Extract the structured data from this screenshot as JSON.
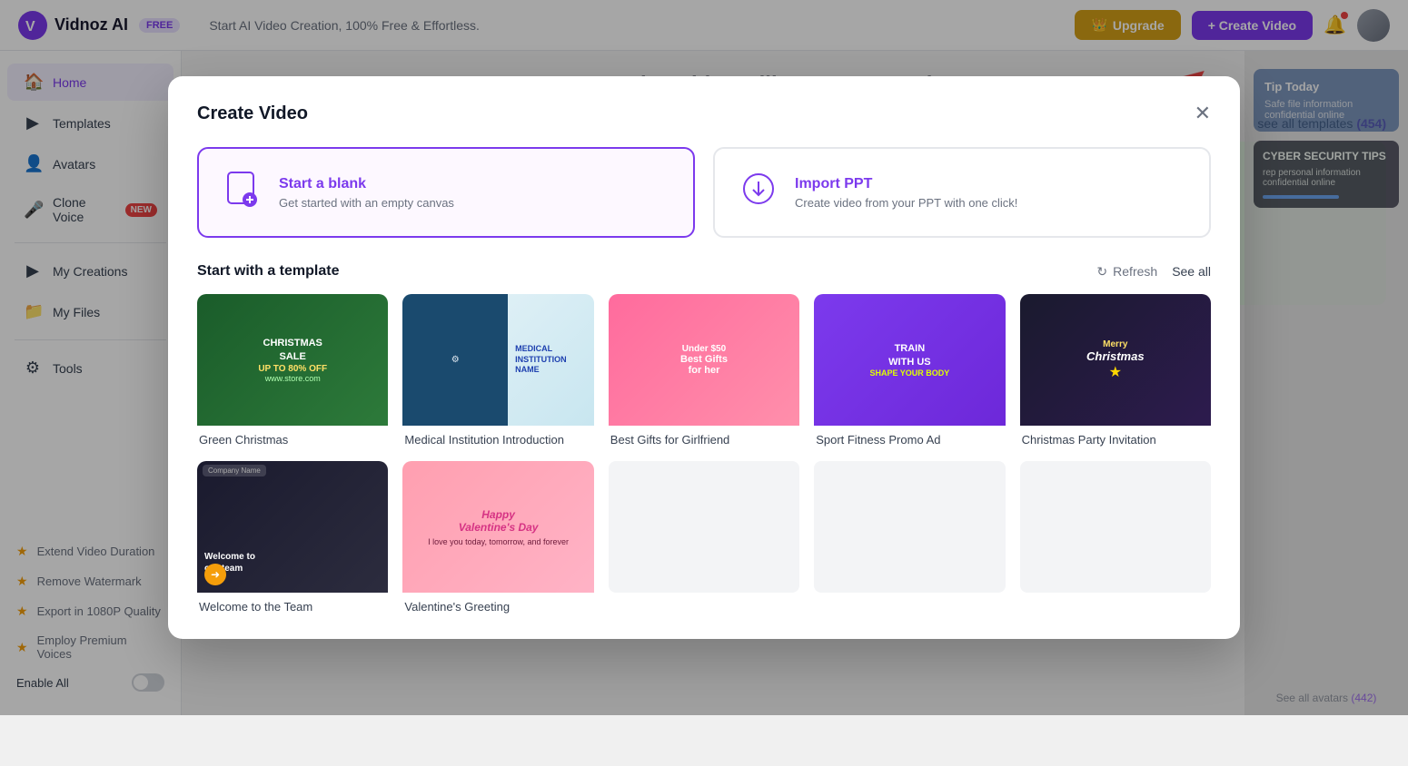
{
  "navbar": {
    "logo_text": "Vidnoz AI",
    "free_badge": "FREE",
    "tagline": "Start AI Video Creation, 100% Free & Effortless.",
    "upgrade_label": "Upgrade",
    "create_video_label": "+ Create Video"
  },
  "sidebar": {
    "items": [
      {
        "id": "home",
        "label": "Home",
        "icon": "🏠"
      },
      {
        "id": "templates",
        "label": "Templates",
        "icon": "▶"
      },
      {
        "id": "avatars",
        "label": "Avatars",
        "icon": "👤"
      },
      {
        "id": "clone-voice",
        "label": "Clone Voice",
        "icon": "🎤",
        "badge": "NEW"
      },
      {
        "id": "my-creations",
        "label": "My Creations",
        "icon": "▶"
      },
      {
        "id": "my-files",
        "label": "My Files",
        "icon": "📁"
      },
      {
        "id": "tools",
        "label": "Tools",
        "icon": "⚙"
      }
    ],
    "bottom_items": [
      {
        "label": "Extend Video Duration"
      },
      {
        "label": "Remove Watermark"
      },
      {
        "label": "Export in 1080P Quality"
      },
      {
        "label": "Employ Premium Voices"
      }
    ],
    "enable_all_label": "Enable All"
  },
  "page": {
    "title": "What video will you create today?"
  },
  "modal": {
    "title": "Create Video",
    "start_blank": {
      "title": "Start a blank",
      "description": "Get started with an empty canvas"
    },
    "import_ppt": {
      "title": "Import PPT",
      "description": "Create video from your PPT with one click!"
    },
    "templates_section": {
      "title": "Start with a template",
      "refresh_label": "Refresh",
      "see_all_label": "See all"
    },
    "templates": [
      {
        "id": "green-christmas",
        "name": "Green Christmas",
        "thumb_label": "CHRISTMAS\nSALE\nUP TO 80% OFF",
        "type": "green-christmas"
      },
      {
        "id": "medical",
        "name": "Medical Institution Introduction",
        "thumb_label": "MEDICAL INSTITUTION NAME",
        "type": "medical"
      },
      {
        "id": "gifts",
        "name": "Best Gifts for Girlfriend",
        "thumb_label": "Under $50\nBest Gifts for her",
        "type": "gifts"
      },
      {
        "id": "sport",
        "name": "Sport Fitness Promo Ad",
        "thumb_label": "TRAIN\nWITH US\nSHAPE YOUR BODY",
        "type": "sport"
      },
      {
        "id": "christmas2",
        "name": "Christmas Party Invitation",
        "thumb_label": "Merry\nChristmas",
        "type": "christmas2"
      },
      {
        "id": "welcome",
        "name": "Welcome to the Team",
        "thumb_label": "Welcome to\nour team",
        "type": "welcome"
      },
      {
        "id": "valentine",
        "name": "Valentine's Greeting",
        "thumb_label": "Happy\nValentine's Day",
        "type": "valentine"
      }
    ]
  },
  "background": {
    "see_all_templates": "see all templates",
    "templates_count": "(454)",
    "see_all_avatars": "See all avatars",
    "avatars_count": "(442)",
    "tip_label": "Tip Today"
  }
}
